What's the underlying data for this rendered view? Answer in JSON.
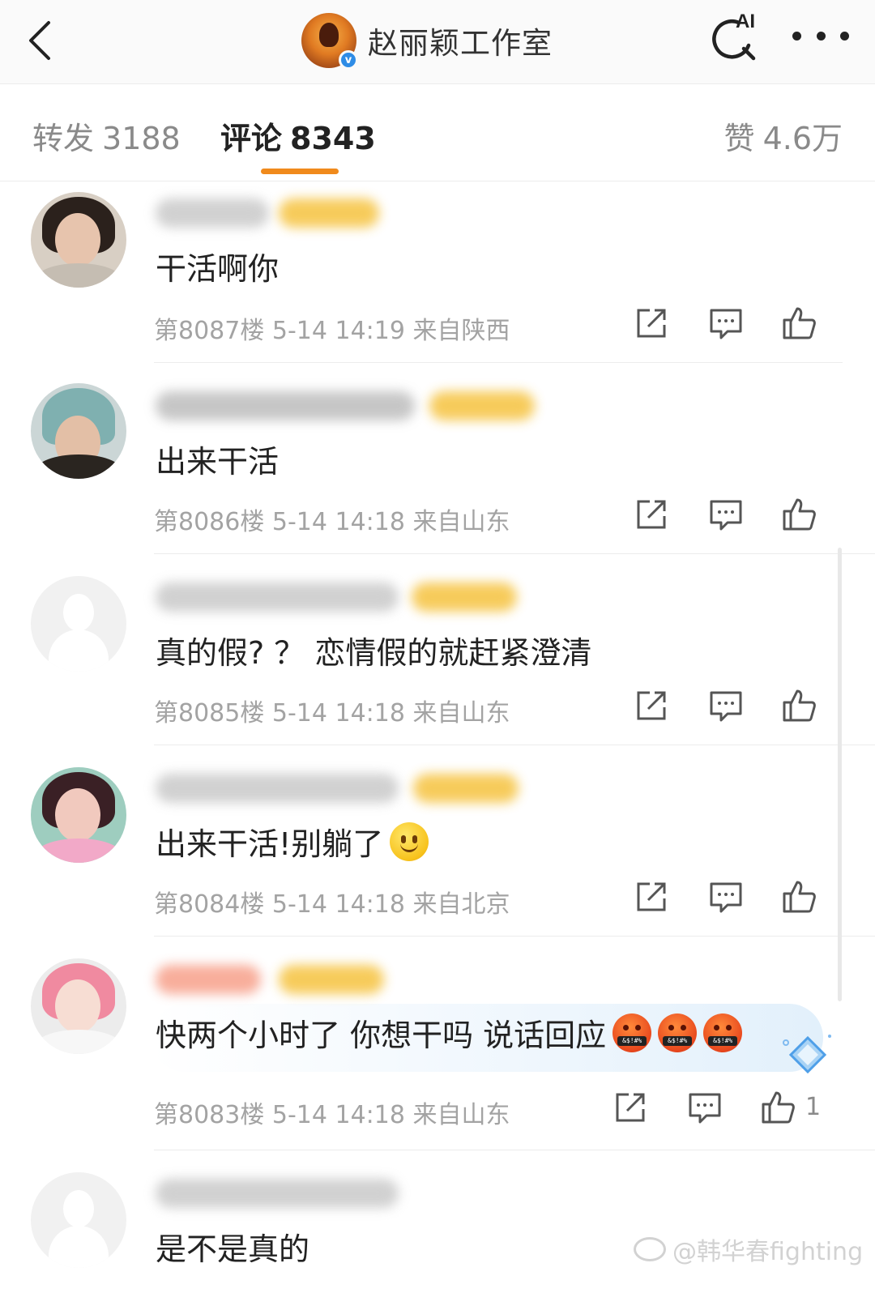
{
  "header": {
    "title": "赵丽颖工作室",
    "verified_mark": "v",
    "ai_label": "AI"
  },
  "tabs": {
    "repost_label": "转发",
    "repost_count": "3188",
    "comment_label": "评论",
    "comment_count": "8343",
    "like_label": "赞",
    "like_count": "4.6万",
    "active": "comment"
  },
  "comments": [
    {
      "text": "干活啊你",
      "meta": "第8087楼 5-14 14:19 来自陕西"
    },
    {
      "text": "出来干活",
      "meta": "第8086楼 5-14 14:18 来自山东"
    },
    {
      "text": "真的假? ？ 恋情假的就赶紧澄清",
      "meta": "第8085楼 5-14 14:18 来自山东"
    },
    {
      "text": "出来干活!别躺了",
      "meta": "第8084楼 5-14 14:18 来自北京",
      "emoji": "smile-emoji"
    },
    {
      "text": "快两个小时了 你想干吗 说话回应",
      "meta": "第8083楼 5-14 14:18 来自山东",
      "emoji": "angry-emoji",
      "emoji_text": "&$!#%",
      "likes": "1"
    },
    {
      "text": "是不是真的"
    }
  ],
  "watermark": "@韩华春fighting",
  "colors": {
    "accent": "#f08a1c",
    "verified": "#2e8ce6",
    "meta_text": "#a3a3a3"
  }
}
